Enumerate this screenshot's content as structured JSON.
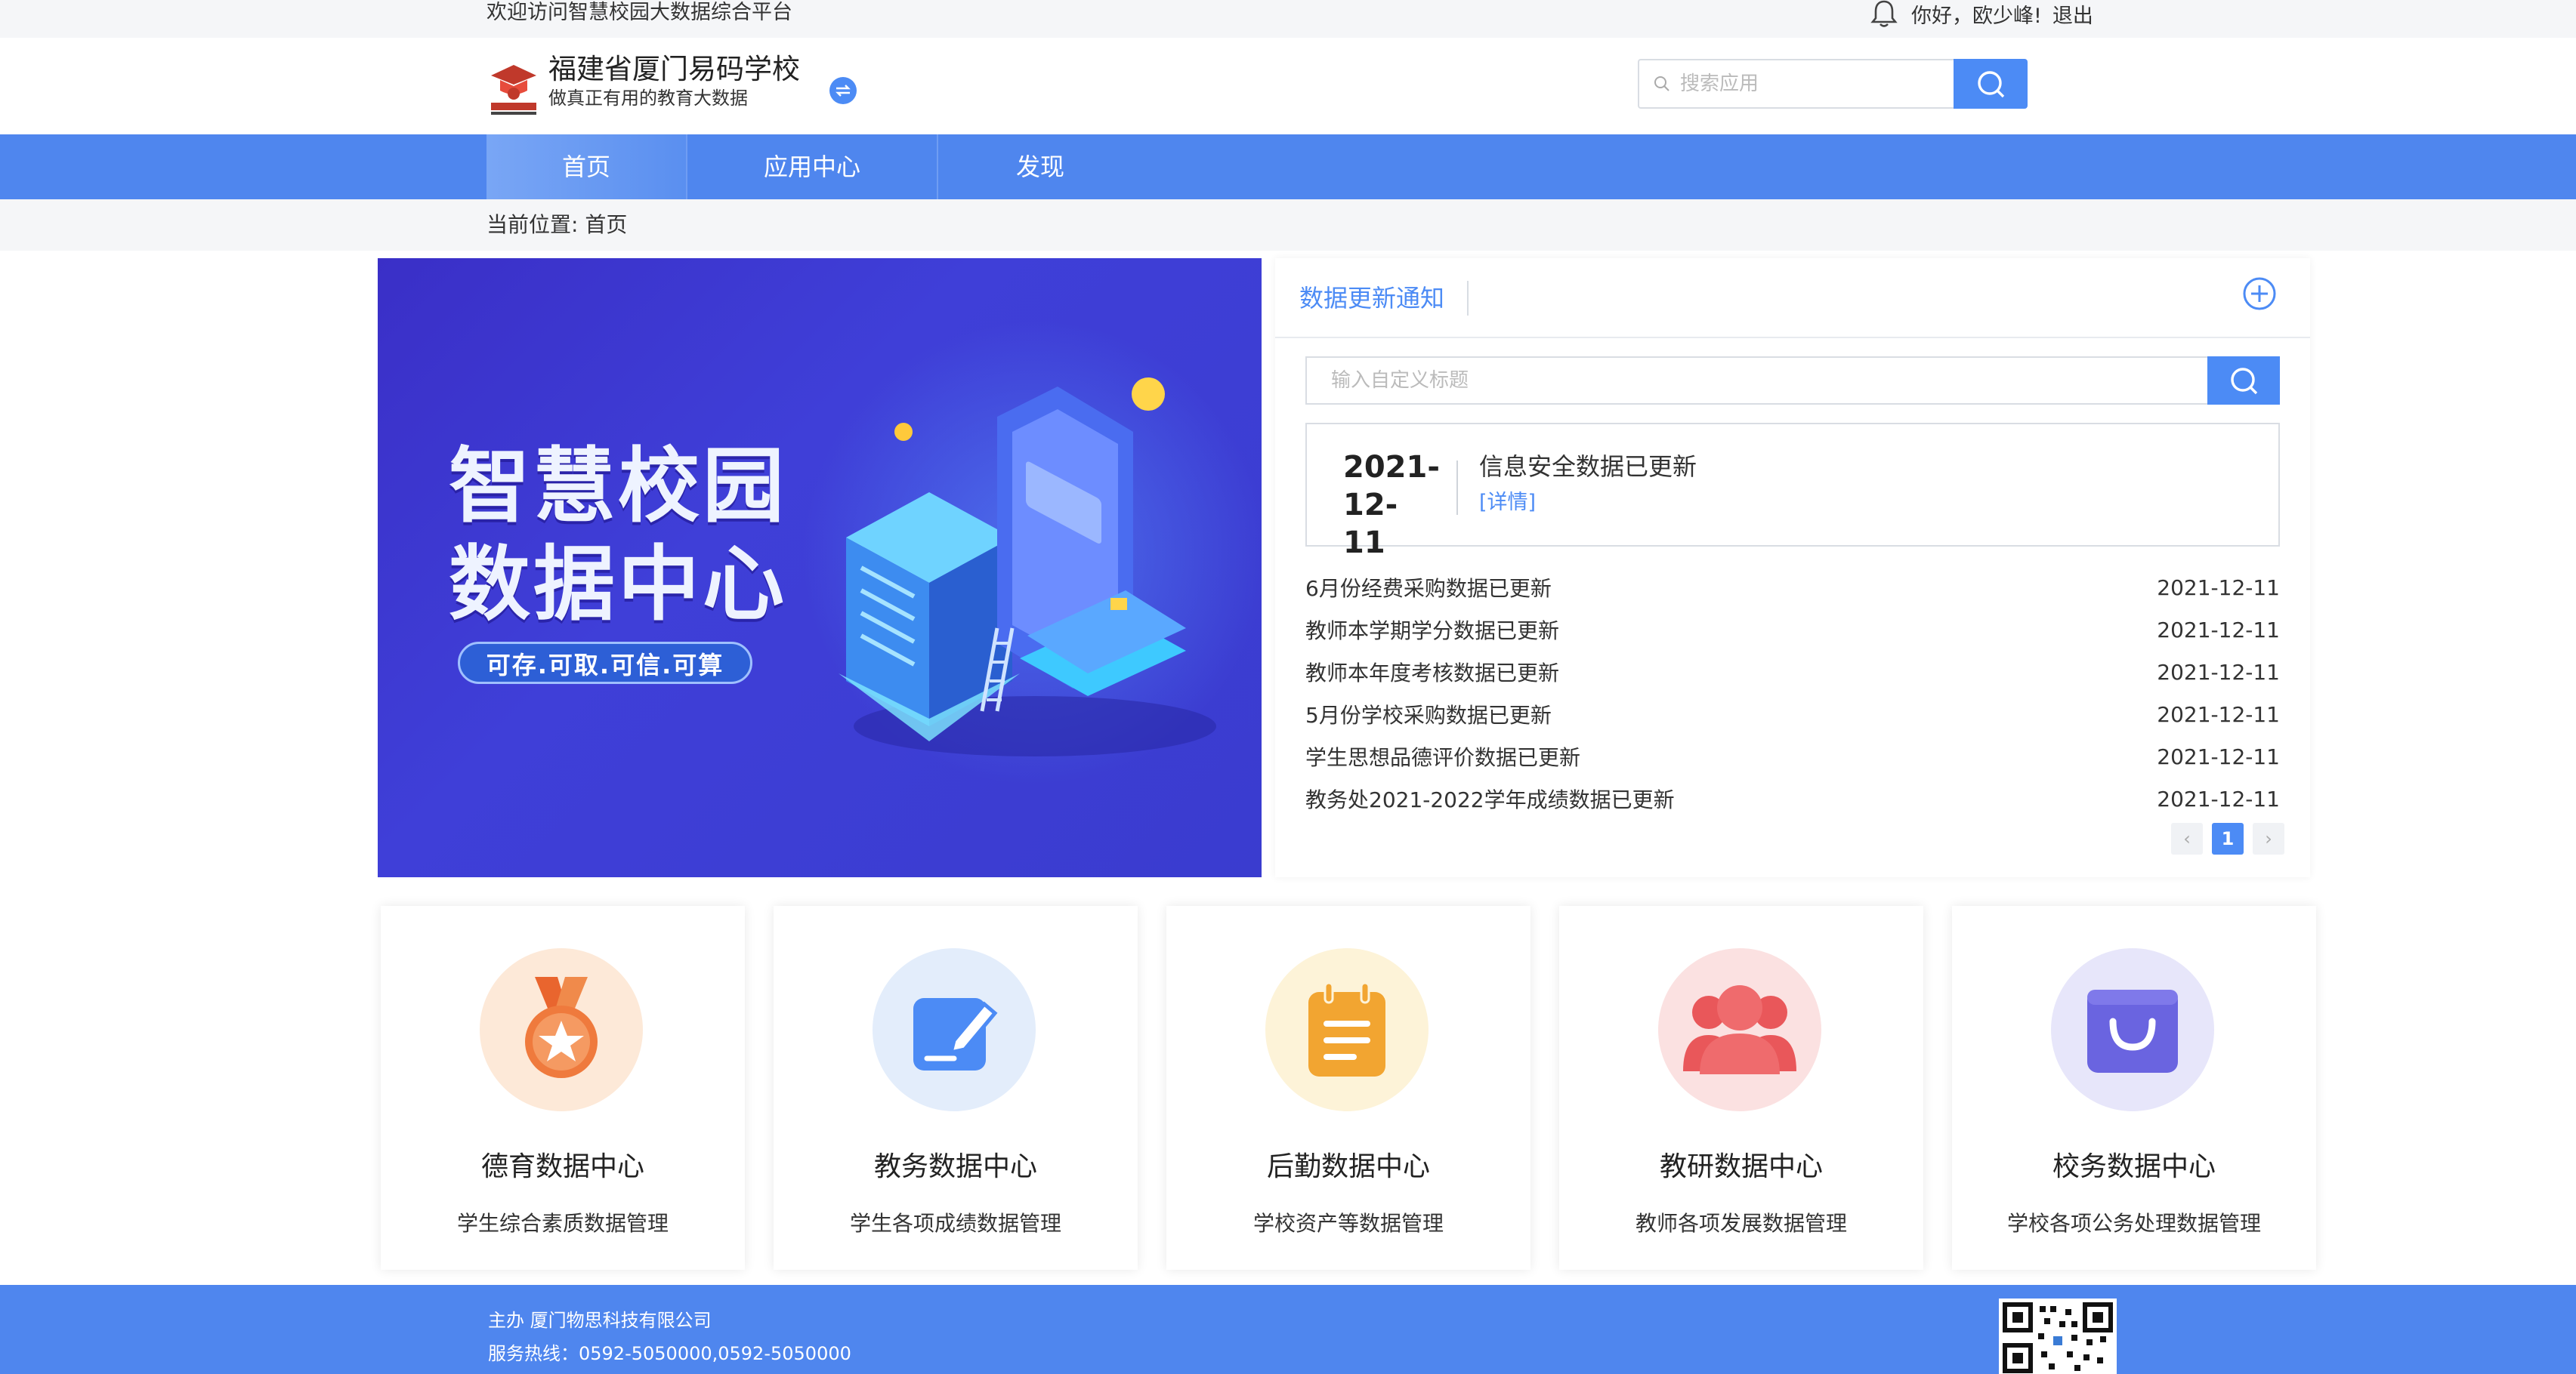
{
  "topbar": {
    "welcome": "欢迎访问智慧校园大数据综合平台",
    "greeting": "你好，欧少峰!",
    "logout": "退出"
  },
  "header": {
    "school_name": "福建省厦门易码学校",
    "slogan": "做真正有用的教育大数据",
    "search_placeholder": "搜索应用"
  },
  "nav": {
    "items": [
      {
        "label": "首页",
        "active": true
      },
      {
        "label": "应用中心",
        "active": false
      },
      {
        "label": "发现",
        "active": false
      }
    ]
  },
  "breadcrumb": {
    "prefix": "当前位置:",
    "current": "首页"
  },
  "banner": {
    "line1": "智慧校园",
    "line2": "数据中心",
    "tagline": "可存.可取.可信.可算"
  },
  "notice": {
    "title": "数据更新通知",
    "search_placeholder": "输入自定义标题",
    "featured": {
      "date": "2021-12-11",
      "title": "信息安全数据已更新",
      "detail": "[详情]"
    },
    "items": [
      {
        "title": "6月份经费采购数据已更新",
        "date": "2021-12-11"
      },
      {
        "title": "教师本学期学分数据已更新",
        "date": "2021-12-11"
      },
      {
        "title": "教师本年度考核数据已更新",
        "date": "2021-12-11"
      },
      {
        "title": "5月份学校采购数据已更新",
        "date": "2021-12-11"
      },
      {
        "title": "学生思想品德评价数据已更新",
        "date": "2021-12-11"
      },
      {
        "title": "教务处2021-2022学年成绩数据已更新",
        "date": "2021-12-11"
      }
    ],
    "pager": {
      "prev": "‹",
      "current": "1",
      "next": "›"
    }
  },
  "cards": [
    {
      "title": "德育数据中心",
      "desc": "学生综合素质数据管理",
      "icon": "medal-icon",
      "bg": "#fde9d8",
      "color": "#ef7a3d"
    },
    {
      "title": "教务数据中心",
      "desc": "学生各项成绩数据管理",
      "icon": "edit-icon",
      "bg": "#e3edfb",
      "color": "#4c8bf5"
    },
    {
      "title": "后勤数据中心",
      "desc": "学校资产等数据管理",
      "icon": "notepad-icon",
      "bg": "#fdf3d8",
      "color": "#f2a531"
    },
    {
      "title": "教研数据中心",
      "desc": "教师各项发展数据管理",
      "icon": "group-icon",
      "bg": "#fbe1e1",
      "color": "#e9575a"
    },
    {
      "title": "校务数据中心",
      "desc": "学校各项公务处理数据管理",
      "icon": "bag-icon",
      "bg": "#e7e6fa",
      "color": "#6a64e0"
    }
  ],
  "footer": {
    "host": "主办 厦门物思科技有限公司",
    "hotline": "服务热线：0592-5050000,0592-5050000"
  }
}
